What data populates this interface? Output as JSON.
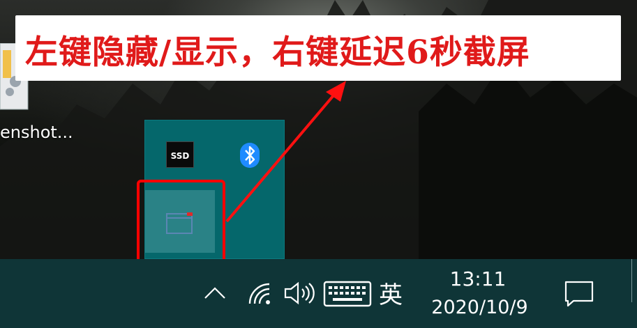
{
  "banner": {
    "text": "左键隐藏/显示，右键延迟6秒截屏",
    "color": "#e01a1a"
  },
  "desktop": {
    "icon_label": "enshot..."
  },
  "tray_popup": {
    "items": [
      {
        "name": "ssd-drive-monitor",
        "label": "SSD"
      },
      {
        "name": "bluetooth"
      },
      {
        "name": "screenshot-app"
      }
    ]
  },
  "taskbar": {
    "show_hidden_icons": "^",
    "input_method": "英",
    "clock": {
      "time": "13:11",
      "date": "2020/10/9"
    },
    "icons": [
      "chevron-up-icon",
      "wifi-icon",
      "volume-icon",
      "keyboard-icon",
      "action-center-icon"
    ]
  },
  "colors": {
    "taskbar": "#0f3537",
    "popup": "#05676b",
    "highlight": "#2a8286",
    "annotation": "#ff0000",
    "bluetooth": "#1f8bff"
  }
}
